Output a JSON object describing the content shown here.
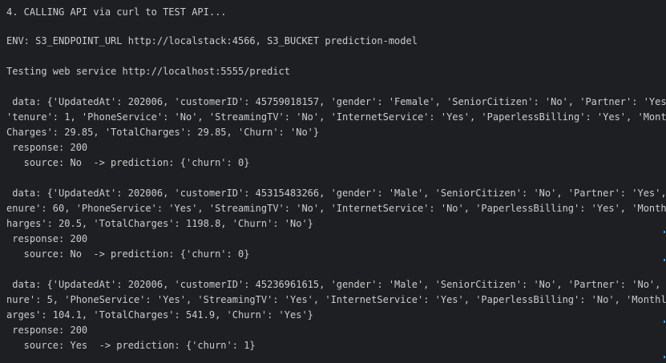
{
  "terminal": {
    "lines": [
      "4. CALLING API via curl to TEST API...",
      "",
      "ENV: S3_ENDPOINT_URL http://localstack:4566, S3_BUCKET prediction-model",
      "",
      "Testing web service http://localhost:5555/predict",
      "",
      " data: {'UpdatedAt': 202006, 'customerID': 45759018157, 'gender': 'Female', 'SeniorCitizen': 'No', 'Partner': 'Yes', 'D",
      "'tenure': 1, 'PhoneService': 'No', 'StreamingTV': 'No', 'InternetService': 'Yes', 'PaperlessBilling': 'Yes', 'Monthly",
      "Charges': 29.85, 'TotalCharges': 29.85, 'Churn': 'No'}",
      " response: 200",
      "   source: No  -> prediction: {'churn': 0}",
      "",
      " data: {'UpdatedAt': 202006, 'customerID': 45315483266, 'gender': 'Male', 'SeniorCitizen': 'No', 'Partner': 'Yes', 't",
      "enure': 60, 'PhoneService': 'Yes', 'StreamingTV': 'No', 'InternetService': 'No', 'PaperlessBilling': 'Yes', 'MonthlyC",
      "harges': 20.5, 'TotalCharges': 1198.8, 'Churn': 'No'}",
      " response: 200",
      "   source: No  -> prediction: {'churn': 0}",
      "",
      " data: {'UpdatedAt': 202006, 'customerID': 45236961615, 'gender': 'Male', 'SeniorCitizen': 'No', 'Partner': 'No', 'te",
      "nure': 5, 'PhoneService': 'Yes', 'StreamingTV': 'Yes', 'InternetService': 'Yes', 'PaperlessBilling': 'No', 'MonthlyCh",
      "arges': 104.1, 'TotalCharges': 541.9, 'Churn': 'Yes'}",
      " response: 200",
      "   source: Yes  -> prediction: {'churn': 1}"
    ]
  }
}
